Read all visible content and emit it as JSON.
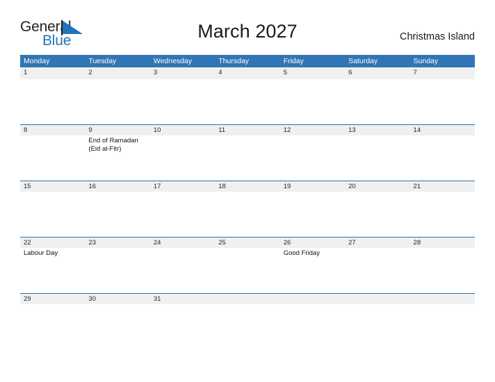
{
  "brand": {
    "name_part1": "General",
    "name_part2": "Blue",
    "flag_icon": "blue-flag-triangle",
    "color_dark": "#231f20",
    "color_blue": "#1f76bc"
  },
  "header": {
    "title": "March 2027",
    "country": "Christmas Island"
  },
  "theme": {
    "header_blue": "#3275b4",
    "separator_blue": "#2e6da8",
    "date_band_gray": "#f0f0f0",
    "text_dark": "#262626"
  },
  "calendar": {
    "weekdays": [
      "Monday",
      "Tuesday",
      "Wednesday",
      "Thursday",
      "Friday",
      "Saturday",
      "Sunday"
    ],
    "weeks": [
      {
        "dates": [
          "1",
          "2",
          "3",
          "4",
          "5",
          "6",
          "7"
        ],
        "events": [
          [],
          [],
          [],
          [],
          [],
          [],
          []
        ]
      },
      {
        "dates": [
          "8",
          "9",
          "10",
          "11",
          "12",
          "13",
          "14"
        ],
        "events": [
          [],
          [
            "End of Ramadan",
            "(Eid al-Fitr)"
          ],
          [],
          [],
          [],
          [],
          []
        ]
      },
      {
        "dates": [
          "15",
          "16",
          "17",
          "18",
          "19",
          "20",
          "21"
        ],
        "events": [
          [],
          [],
          [],
          [],
          [],
          [],
          []
        ]
      },
      {
        "dates": [
          "22",
          "23",
          "24",
          "25",
          "26",
          "27",
          "28"
        ],
        "events": [
          [
            "Labour Day"
          ],
          [],
          [],
          [],
          [
            "Good Friday"
          ],
          [],
          []
        ]
      },
      {
        "dates": [
          "29",
          "30",
          "31",
          "",
          "",
          "",
          ""
        ],
        "events": [
          [],
          [],
          [],
          [],
          [],
          [],
          []
        ]
      }
    ]
  }
}
